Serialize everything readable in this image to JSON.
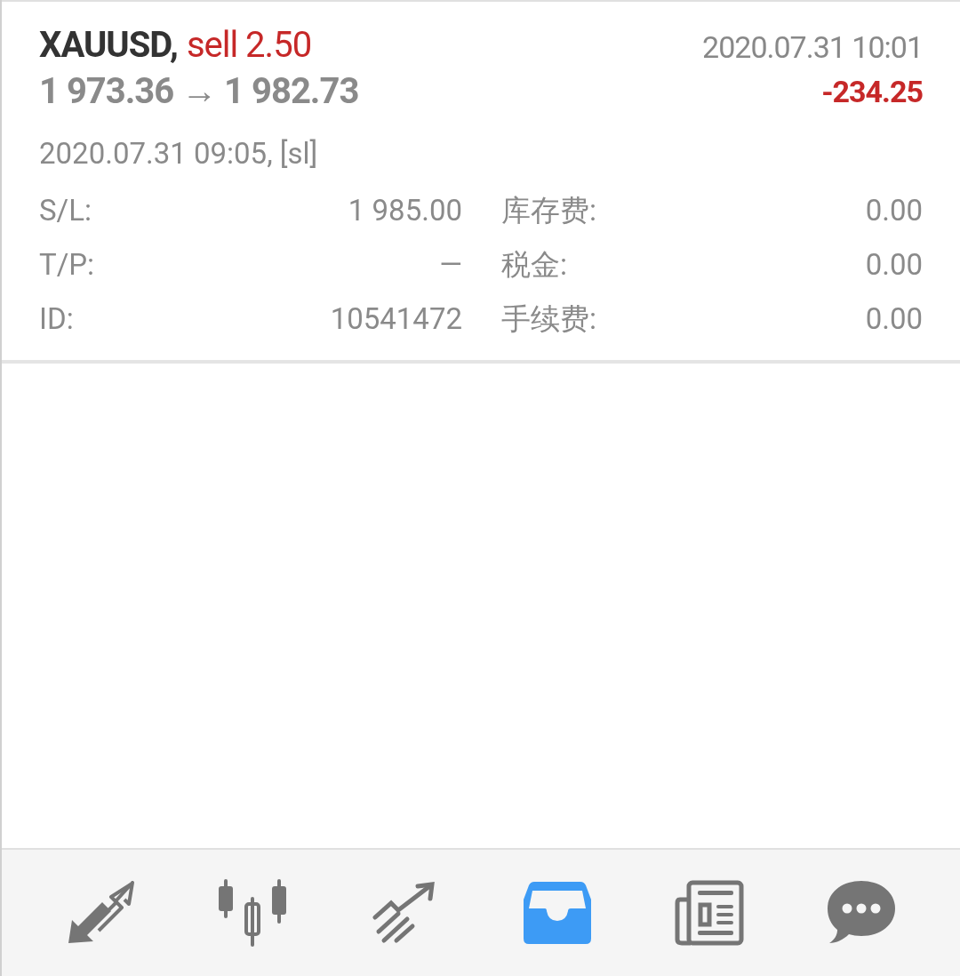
{
  "trade": {
    "symbol": "XAUUSD,",
    "side": "sell 2.50",
    "close_time": "2020.07.31 10:01",
    "prices": "1 973.36 → 1 982.73",
    "profit": "-234.25",
    "open_time": "2020.07.31 09:05, [sl]",
    "details": [
      {
        "label": "S/L:",
        "value": "1 985.00",
        "label_2": "库存费:",
        "value_2": "0.00"
      },
      {
        "label": "T/P:",
        "value": "—",
        "label_2": "税金:",
        "value_2": "0.00"
      },
      {
        "label": "ID:",
        "value": "10541472",
        "label_2": "手续费:",
        "value_2": "0.00"
      }
    ]
  },
  "tab_bar": [
    {
      "kind": "trade",
      "selected": false
    },
    {
      "kind": "quotes",
      "selected": false
    },
    {
      "kind": "chart",
      "selected": false
    },
    {
      "kind": "history",
      "selected": true
    },
    {
      "kind": "news",
      "selected": false
    },
    {
      "kind": "chat",
      "selected": false
    }
  ]
}
